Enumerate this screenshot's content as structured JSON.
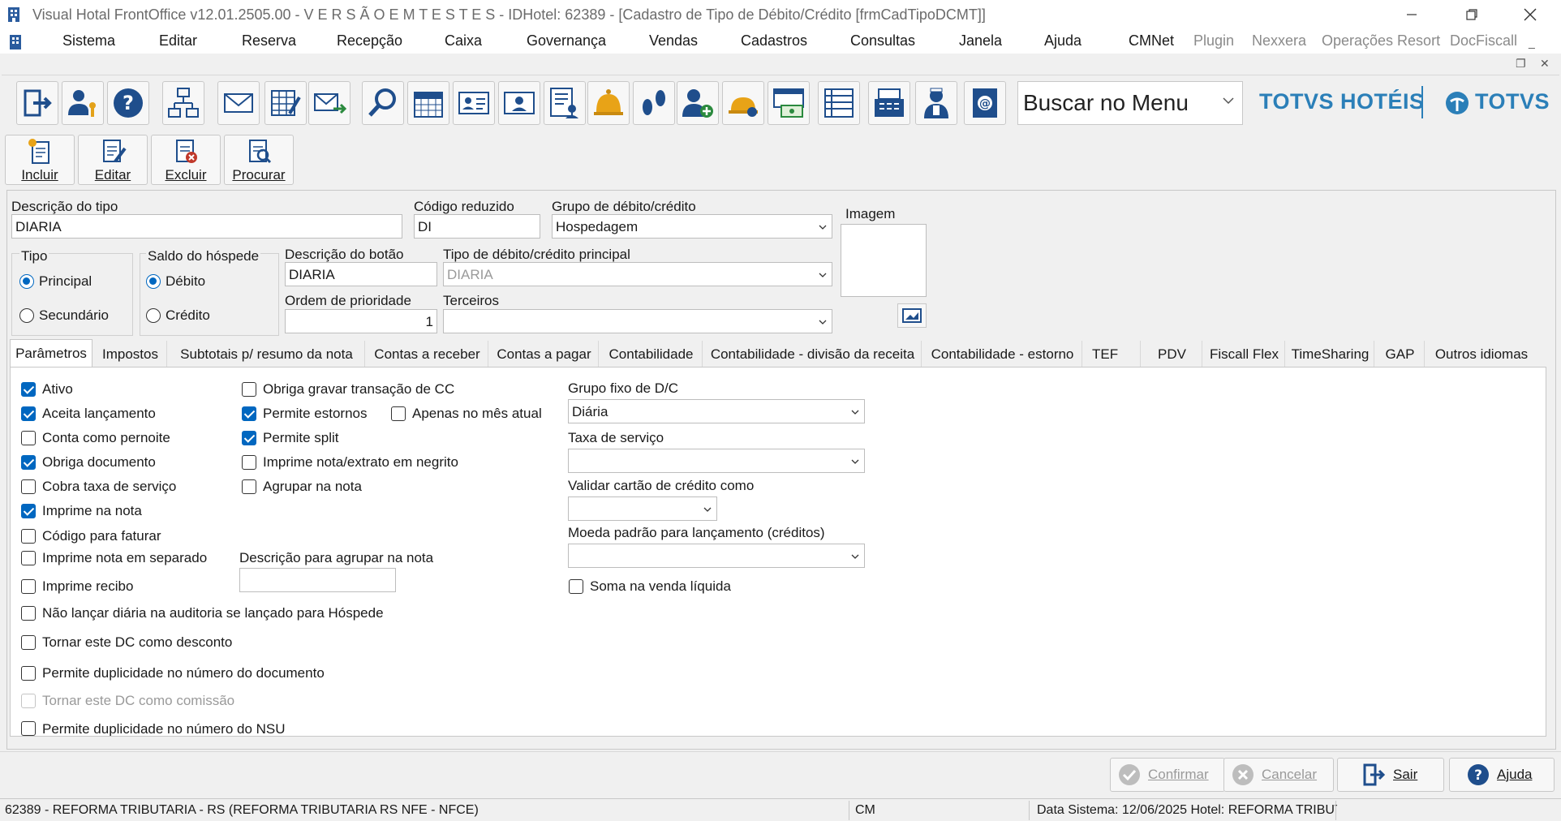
{
  "window": {
    "title": "Visual Hotal FrontOffice v12.01.2505.00 - V E R S Ã O   E M   T E S T E S   - IDHotel: 62389 - [Cadastro de Tipo de Débito/Crédito [frmCadTipoDCMT]]",
    "icon": "hotel-building-icon"
  },
  "menu": {
    "items": [
      "Sistema",
      "Editar",
      "Reserva",
      "Recepção",
      "Caixa",
      "Governança",
      "Vendas",
      "Cadastros",
      "Consultas",
      "Janela",
      "Ajuda",
      "CMNet"
    ],
    "disabled_items": [
      "Plugin",
      "Nexxera",
      "Operações Resort",
      "DocFiscall"
    ]
  },
  "toolbar": {
    "icons": [
      "exit-door-icon",
      "user-key-icon",
      "help-icon",
      "network-icon",
      "mail-icon",
      "spreadsheet-edit-icon",
      "mail-send-icon",
      "search-icon",
      "calendar-icon",
      "id-card-icon",
      "guest-card-icon",
      "report-user-icon",
      "bell-icon",
      "footprints-icon",
      "add-user-icon",
      "reception-bell-icon",
      "cash-document-icon",
      "list-icon",
      "cash-register-icon",
      "maid-icon",
      "contact-email-icon"
    ],
    "search_placeholder": "Buscar no Menu",
    "brand_hotels": "TOTVS HOTÉIS",
    "brand_totvs": "TOTVS"
  },
  "actions": {
    "incluir": "Incluir",
    "editar": "Editar",
    "excluir": "Excluir",
    "procurar": "Procurar"
  },
  "form": {
    "descricao_tipo_label": "Descrição do tipo",
    "descricao_tipo_value": "DIARIA",
    "codigo_reduzido_label": "Código reduzido",
    "codigo_reduzido_value": "DI",
    "grupo_label": "Grupo de débito/crédito",
    "grupo_value": "Hospedagem",
    "imagem_label": "Imagem",
    "tipo_label": "Tipo",
    "tipo_principal": "Principal",
    "tipo_secundario": "Secundário",
    "saldo_label": "Saldo do hóspede",
    "saldo_debito": "Débito",
    "saldo_credito": "Crédito",
    "descricao_botao_label": "Descrição do botão",
    "descricao_botao_value": "DIARIA",
    "tipo_principal_label": "Tipo de débito/crédito principal",
    "tipo_principal_value": "DIARIA",
    "ordem_label": "Ordem de prioridade",
    "ordem_value": "1",
    "terceiros_label": "Terceiros",
    "terceiros_value": ""
  },
  "tabs": [
    "Parâmetros",
    "Impostos",
    "Subtotais p/ resumo da nota",
    "Contas a receber",
    "Contas a pagar",
    "Contabilidade",
    "Contabilidade - divisão da receita",
    "Contabilidade - estorno",
    "TEF",
    "PDV",
    "Fiscall Flex",
    "TimeSharing",
    "GAP",
    "Outros idiomas"
  ],
  "params": {
    "col1": [
      {
        "label": "Ativo",
        "checked": true
      },
      {
        "label": "Aceita lançamento",
        "checked": true
      },
      {
        "label": "Conta como pernoite",
        "checked": false
      },
      {
        "label": "Obriga documento",
        "checked": true
      },
      {
        "label": "Cobra taxa de serviço",
        "checked": false
      },
      {
        "label": "Imprime na nota",
        "checked": true
      },
      {
        "label": "Código para faturar",
        "checked": false
      },
      {
        "label": "Imprime nota em separado",
        "checked": false
      },
      {
        "label": "Imprime recibo",
        "checked": false
      },
      {
        "label": "Não lançar diária na auditoria se lançado para Hóspede",
        "checked": false
      },
      {
        "label": "Tornar este DC como desconto",
        "checked": false
      },
      {
        "label": "Permite duplicidade no número do documento",
        "checked": false
      },
      {
        "label": "Tornar este DC como comissão",
        "checked": false,
        "disabled": true
      },
      {
        "label": "Permite duplicidade no número do NSU",
        "checked": false
      }
    ],
    "col2": [
      {
        "label": "Obriga gravar transação de CC",
        "checked": false
      },
      {
        "label": "Permite estornos",
        "checked": true
      },
      {
        "label": "Apenas no mês atual",
        "checked": false
      },
      {
        "label": "Permite split",
        "checked": true
      },
      {
        "label": "Imprime nota/extrato em negrito",
        "checked": false
      },
      {
        "label": "Agrupar na nota",
        "checked": false
      }
    ],
    "descricao_agrupar_label": "Descrição para agrupar na nota",
    "descricao_agrupar_value": "",
    "grupo_fixo_label": "Grupo fixo de D/C",
    "grupo_fixo_value": "Diária",
    "taxa_servico_label": "Taxa de serviço",
    "taxa_servico_value": "",
    "validar_cartao_label": "Validar cartão de crédito como",
    "validar_cartao_value": "",
    "moeda_label": "Moeda padrão para lançamento (créditos)",
    "moeda_value": "",
    "soma_venda_label": "Soma na venda líquida",
    "soma_venda_checked": false
  },
  "bottom": {
    "confirmar": "Confirmar",
    "cancelar": "Cancelar",
    "sair": "Sair",
    "ajuda": "Ajuda"
  },
  "status": {
    "hotel": "62389 - REFORMA TRIBUTARIA - RS (REFORMA TRIBUTARIA RS NFE - NFCE)",
    "user": "CM",
    "system_info": "Data Sistema: 12/06/2025  Hotel: REFORMA TRIBUT"
  }
}
